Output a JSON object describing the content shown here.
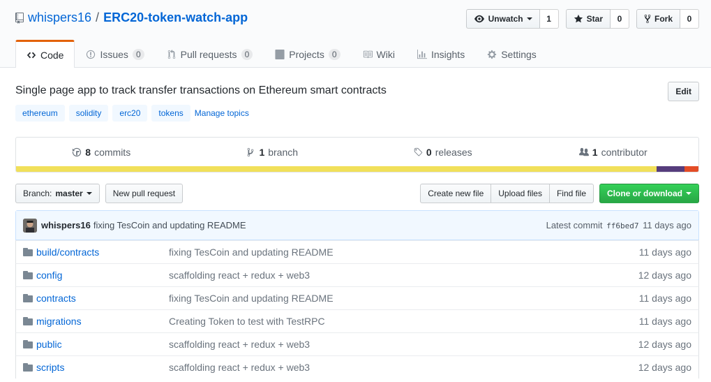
{
  "repo": {
    "owner": "whispers16",
    "separator": "/",
    "name": "ERC20-token-watch-app",
    "description": "Single page app to track transfer transactions on Ethereum smart contracts",
    "edit_label": "Edit"
  },
  "actions": {
    "watch_label": "Unwatch",
    "watch_count": "1",
    "star_label": "Star",
    "star_count": "0",
    "fork_label": "Fork",
    "fork_count": "0"
  },
  "tabs": [
    {
      "label": "Code",
      "icon": "code-icon",
      "count": ""
    },
    {
      "label": "Issues",
      "icon": "issue-icon",
      "count": "0"
    },
    {
      "label": "Pull requests",
      "icon": "pull-request-icon",
      "count": "0"
    },
    {
      "label": "Projects",
      "icon": "project-icon",
      "count": "0"
    },
    {
      "label": "Wiki",
      "icon": "book-icon",
      "count": ""
    },
    {
      "label": "Insights",
      "icon": "graph-icon",
      "count": ""
    },
    {
      "label": "Settings",
      "icon": "gear-icon",
      "count": ""
    }
  ],
  "topics": [
    "ethereum",
    "solidity",
    "erc20",
    "tokens"
  ],
  "manage_topics": "Manage topics",
  "numbers": {
    "commits_count": "8",
    "commits_label": "commits",
    "branch_count": "1",
    "branch_label": "branch",
    "releases_count": "0",
    "releases_label": "releases",
    "contributors_count": "1",
    "contributors_label": "contributor"
  },
  "language_bar": [
    {
      "color": "#f1e05a",
      "fraction": 0.939
    },
    {
      "color": "#563d7c",
      "fraction": 0.041
    },
    {
      "color": "#e34c26",
      "fraction": 0.02
    }
  ],
  "file_nav": {
    "branch_prefix": "Branch:",
    "branch_name": "master",
    "new_pr": "New pull request",
    "create_file": "Create new file",
    "upload_files": "Upload files",
    "find_file": "Find file",
    "clone_download": "Clone or download"
  },
  "commit_tease": {
    "author": "whispers16",
    "message": "fixing TesCoin and updating README",
    "latest_label": "Latest commit",
    "sha": "ff6bed7",
    "age": "11 days ago"
  },
  "files": [
    {
      "name_prefix": "build/",
      "name": "contracts",
      "message": "fixing TesCoin and updating README",
      "age": "11 days ago"
    },
    {
      "name_prefix": "",
      "name": "config",
      "message": "scaffolding react + redux + web3",
      "age": "12 days ago"
    },
    {
      "name_prefix": "",
      "name": "contracts",
      "message": "fixing TesCoin and updating README",
      "age": "11 days ago"
    },
    {
      "name_prefix": "",
      "name": "migrations",
      "message": "Creating Token to test with TestRPC",
      "age": "11 days ago"
    },
    {
      "name_prefix": "",
      "name": "public",
      "message": "scaffolding react + redux + web3",
      "age": "12 days ago"
    },
    {
      "name_prefix": "",
      "name": "scripts",
      "message": "scaffolding react + redux + web3",
      "age": "12 days ago"
    }
  ]
}
